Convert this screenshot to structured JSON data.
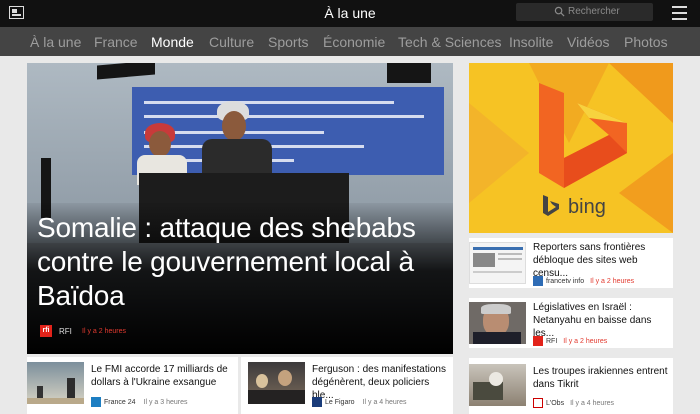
{
  "app": {
    "title": "À la une",
    "search_placeholder": "Rechercher"
  },
  "nav": {
    "items": [
      {
        "label": "À la une",
        "active": false
      },
      {
        "label": "France",
        "active": false
      },
      {
        "label": "Monde",
        "active": true
      },
      {
        "label": "Culture",
        "active": false
      },
      {
        "label": "Sports",
        "active": false
      },
      {
        "label": "Économie",
        "active": false
      },
      {
        "label": "Tech & Sciences",
        "active": false
      },
      {
        "label": "Insolite",
        "active": false
      },
      {
        "label": "Vidéos",
        "active": false
      },
      {
        "label": "Photos",
        "active": false
      }
    ]
  },
  "hero": {
    "title": "Somalie : attaque des shebabs contre le gouvernement local à Baïdoa",
    "source": "RFI",
    "source_logo": "rfi",
    "time": "Il y a 2 heures"
  },
  "ad": {
    "brand": "bing",
    "colors": {
      "bg": "#f6c324",
      "accent": "#f0b323",
      "deep": "#f29b1a"
    }
  },
  "side": [
    {
      "title": "Reporters sans frontières débloque des sites web censu...",
      "source": "francetv info",
      "time": "Il y a 2 heures"
    },
    {
      "title": "Législatives en Israël : Netanyahu en baisse dans les...",
      "source": "RFI",
      "time": "Il y a 2 heures"
    },
    {
      "title": "Les troupes irakiennes entrent dans Tikrit",
      "source": "L'Obs",
      "time": "Il y a 4 heures"
    }
  ],
  "bottom": [
    {
      "title": "Le FMI accorde 17 milliards de dollars à l'Ukraine exsangue",
      "source": "France 24",
      "time": "Il y a 3 heures"
    },
    {
      "title": "Ferguson : des manifestations dégénèrent, deux policiers ble...",
      "source": "Le Figaro",
      "time": "Il y a 4 heures"
    }
  ],
  "colors": {
    "time_red": "#e23a2f",
    "nav_bg": "#444444",
    "topbar_bg": "#111111"
  }
}
